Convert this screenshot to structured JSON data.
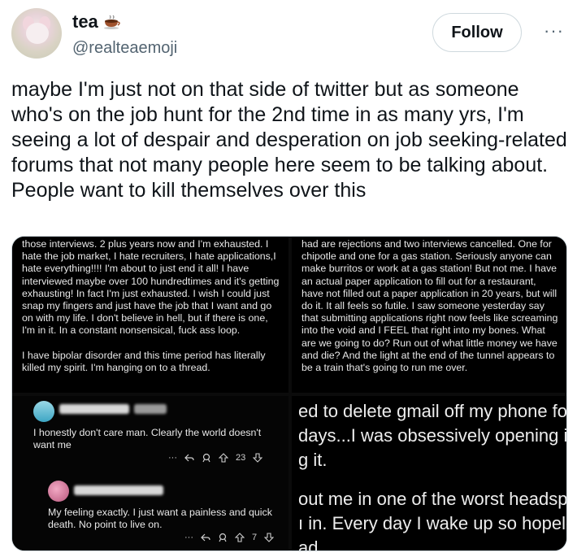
{
  "tweet": {
    "display_name": "tea",
    "name_icon": "teacup-icon",
    "handle": "@realteaemoji",
    "follow_label": "Follow",
    "more_label": "···",
    "text": "maybe I'm just not on that side of twitter but as someone who's on the job hunt for the 2nd time in as many yrs, I'm seeing a lot of despair and desperation on job seeking-related forums that not many people here seem to be talking about. People want to kill themselves over this"
  },
  "media": {
    "panel1": {
      "paragraphs": [
        "those interviews. 2 plus years now and I'm exhausted. I hate the job market, I hate recruiters, I hate applications,I hate everything!!!! I'm about to just end it all! I have interviewed maybe over 100 hundredtimes and it's getting exhausting! In fact I'm just exhausted. I wish I could just snap my fingers and just have the job that I want and go on with my life. I don't believe in hell, but if there is one, I'm in it. In a constant nonsensical, fuck ass loop.",
        "I have bipolar disorder and this time period has literally killed my spirit. I'm hanging on to a thread."
      ]
    },
    "panel2": {
      "text": "had are rejections and two interviews cancelled. One for chipotle and one for a gas station. Seriously anyone can make burritos or work at a gas station! But not me. I have an actual paper application to fill out for a restaurant, have not filled out a paper application in 20 years, but will do it. It all feels so futile. I saw someone yesterday say that submitting applications right now feels like screaming into the void and I FEEL that right into my bones. What are we going to do? Run out of what little money we have and die? And the light at the end of the tunnel appears to be a train that's going to run me over."
    },
    "panel3": {
      "comments": [
        {
          "text": "I honestly don't care man. Clearly the world doesn't want me",
          "more": "···",
          "votes": "23"
        },
        {
          "text": "My feeling exactly. I just want a painless and quick death. No point to live on.",
          "more": "···",
          "votes": "7"
        }
      ]
    },
    "panel4": {
      "paragraphs": [
        "ed to delete gmail off my phone fo\ndays...I was obsessively opening it\nɡ it.",
        "out me in one of the worst headspa\nı in. Every day I wake up so hopele\nad."
      ]
    }
  }
}
